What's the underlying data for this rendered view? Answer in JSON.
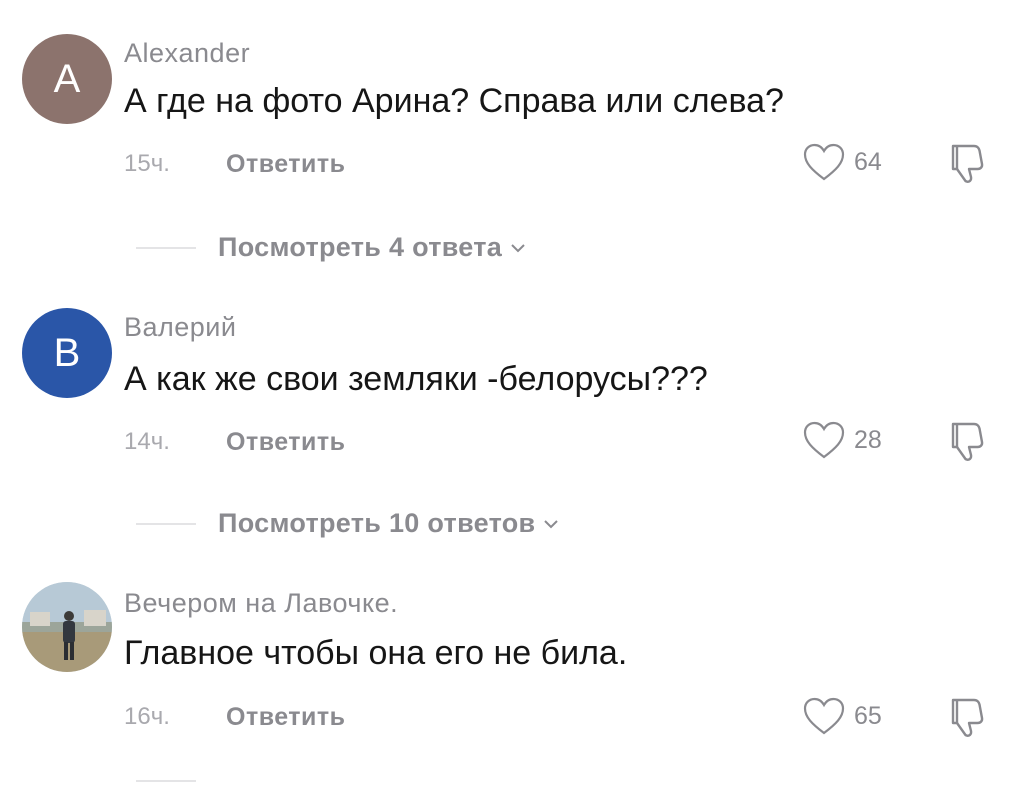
{
  "colors": {
    "avatar_a": "#8c736d",
    "avatar_b": "#2a56a8",
    "text": "#161616",
    "muted": "#8a8a8f"
  },
  "comments": [
    {
      "avatar_letter": "A",
      "author": "Alexander",
      "text": "А где на фото Арина? Справа или слева?",
      "time": "15ч.",
      "reply_label": "Ответить",
      "likes": "64",
      "replies_label": "Посмотреть 4 ответа"
    },
    {
      "avatar_letter": "B",
      "author": "Валерий",
      "text": "А как же свои земляки -белорусы???",
      "time": "14ч.",
      "reply_label": "Ответить",
      "likes": "28",
      "replies_label": "Посмотреть 10 ответов"
    },
    {
      "avatar_icon": "photo-avatar",
      "author": "Вечером на Лавочке.",
      "text": "Главное чтобы она его не била.",
      "time": "16ч.",
      "reply_label": "Ответить",
      "likes": "65"
    }
  ]
}
